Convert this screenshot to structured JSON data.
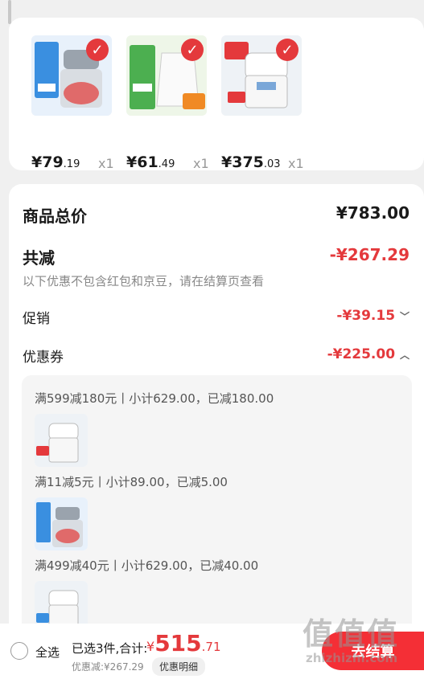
{
  "products": [
    {
      "price_int": "¥79",
      "price_dec": ".19",
      "qty": "x1",
      "image": "meat-grinder"
    },
    {
      "price_int": "¥61",
      "price_dec": ".49",
      "qty": "x1",
      "image": "electric-kettle"
    },
    {
      "price_int": "¥375",
      "price_dec": ".03",
      "qty": "x1",
      "image": "rice-cooker"
    }
  ],
  "summary": {
    "total_label": "商品总价",
    "total_value": "¥783.00",
    "reduce_label": "共减",
    "reduce_value": "-¥267.29",
    "reduce_note": "以下优惠不包含红包和京豆，请在结算页查看",
    "promo_label": "促销",
    "promo_value": "-¥39.15",
    "coupon_label": "优惠券",
    "coupon_value": "-¥225.00"
  },
  "coupons": [
    {
      "title": "满599减180元丨小计629.00，已减180.00",
      "image": "rice-cooker"
    },
    {
      "title": "满11减5元丨小计89.00，已减5.00",
      "image": "meat-grinder"
    },
    {
      "title": "满499减40元丨小计629.00，已减40.00",
      "image": "rice-cooker"
    }
  ],
  "bottom": {
    "select_all": "全选",
    "selected_info": "已选3件,合计:",
    "yen": "¥",
    "total_int": "515",
    "total_dec": ".71",
    "discount": "优惠减:¥267.29",
    "detail_button": "优惠明细",
    "checkout": "去结算"
  },
  "watermark": {
    "big": "值值值",
    "small": "zhizhizhi.com"
  },
  "colors": {
    "accent": "#e4393c",
    "checkout": "#f42f36",
    "background": "#f0f0f0"
  }
}
